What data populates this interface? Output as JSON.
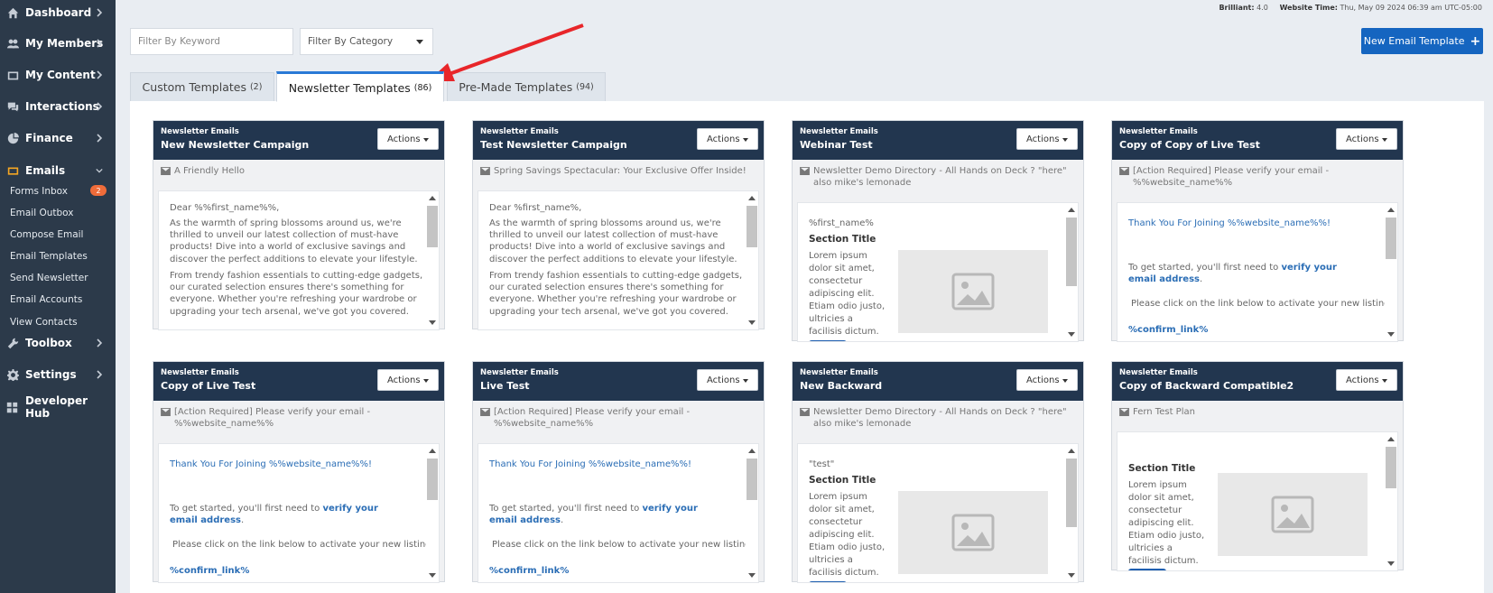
{
  "sidebar": {
    "items": [
      {
        "label": "Dashboard",
        "icon": "home-icon"
      },
      {
        "label": "My Members",
        "icon": "users-icon"
      },
      {
        "label": "My Content",
        "icon": "content-icon"
      },
      {
        "label": "Interactions",
        "icon": "chat-icon"
      },
      {
        "label": "Finance",
        "icon": "finance-icon"
      },
      {
        "label": "Emails",
        "icon": "envelope-icon"
      },
      {
        "label": "Toolbox",
        "icon": "wrench-icon"
      },
      {
        "label": "Settings",
        "icon": "gear-icon"
      },
      {
        "label": "Developer Hub",
        "icon": "grid-icon"
      }
    ],
    "email_subitems": [
      "Forms Inbox",
      "Email Outbox",
      "Compose Email",
      "Email Templates",
      "Send Newsletter",
      "Email Accounts",
      "View Contacts"
    ],
    "forms_inbox_badge": "2"
  },
  "topbar": {
    "version_label": "Brilliant:",
    "version": "4.0",
    "time_label": "Website Time:",
    "time": "Thu, May 09 2024 06:39 am UTC-05:00"
  },
  "filters": {
    "keyword_placeholder": "Filter By Keyword",
    "category_label": "Filter By Category"
  },
  "new_template_label": "New Email Template",
  "tabs": [
    {
      "label": "Custom Templates",
      "count": "(2)"
    },
    {
      "label": "Newsletter Templates",
      "count": "(86)"
    },
    {
      "label": "Pre-Made Templates",
      "count": "(94)"
    }
  ],
  "actions_label": "Actions",
  "cards": [
    {
      "category": "Newsletter Emails",
      "title": "New Newsletter Campaign",
      "subject": "A Friendly Hello",
      "preview": {
        "greeting": "Dear %%first_name%%,",
        "p1": "As the warmth of spring blossoms around us, we're thrilled to unveil our latest collection of must-have products! Dive into a world of exclusive savings and discover the perfect additions to elevate your lifestyle.",
        "p2": "From trendy fashion essentials to cutting-edge gadgets, our curated selection ensures there's something for everyone. Whether you're refreshing your wardrobe or upgrading your tech arsenal, we've got you covered."
      }
    },
    {
      "category": "Newsletter Emails",
      "title": "Test Newsletter Campaign",
      "subject": "Spring Savings Spectacular: Your Exclusive Offer Inside!",
      "preview": {
        "greeting": "Dear %first_name%,",
        "p1": "As the warmth of spring blossoms around us, we're thrilled to unveil our latest collection of must-have products! Dive into a world of exclusive savings and discover the perfect additions to elevate your lifestyle.",
        "p2": "From trendy fashion essentials to cutting-edge gadgets, our curated selection ensures there's something for everyone. Whether you're refreshing your wardrobe or upgrading your tech arsenal, we've got you covered."
      }
    },
    {
      "category": "Newsletter Emails",
      "title": "Webinar Test",
      "subject": "Newsletter Demo Directory - All Hands on Deck ? \"here\" also mike's lemonade",
      "preview": {
        "top": "%first_name%",
        "section": "Section Title",
        "body": "Lorem ipsum dolor sit amet, consectetur adipiscing elit. Etiam odio justo, ultricies a facilisis dictum."
      }
    },
    {
      "category": "Newsletter Emails",
      "title": "Copy of Copy of Live Test",
      "subject": "[Action Required] Please verify your email - %%website_name%%",
      "preview": {
        "thanks": "Thank You For Joining %%website_name%%!",
        "started": "To get started, you'll first need to",
        "verify": "verify your email address",
        "click": "Please click on the link below to activate your new listing.",
        "link": "%confirm_link%"
      }
    },
    {
      "category": "Newsletter Emails",
      "title": "Copy of Live Test",
      "subject": "[Action Required] Please verify your email - %%website_name%%",
      "preview": {
        "thanks": "Thank You For Joining %%website_name%%!",
        "started": "To get started, you'll first need to",
        "verify": "verify your email address",
        "click": "Please click on the link below to activate your new listing.",
        "link": "%confirm_link%"
      }
    },
    {
      "category": "Newsletter Emails",
      "title": "Live Test",
      "subject": "[Action Required] Please verify your email - %%website_name%%",
      "preview": {
        "thanks": "Thank You For Joining %%website_name%%!",
        "started": "To get started, you'll first need to",
        "verify": "verify your email address",
        "click": "Please click on the link below to activate your new listing.",
        "link": "%confirm_link%"
      }
    },
    {
      "category": "Newsletter Emails",
      "title": "New Backward",
      "subject": "Newsletter Demo Directory - All Hands on Deck ? \"here\" also mike's lemonade",
      "preview": {
        "top": "\"test\"",
        "section": "Section Title",
        "body": "Lorem ipsum dolor sit amet, consectetur adipiscing elit. Etiam odio justo, ultricies a facilisis dictum."
      }
    },
    {
      "category": "Newsletter Emails",
      "title": "Copy of Backward Compatible2",
      "subject": "Fern Test Plan",
      "preview": {
        "top": "",
        "section": "Section Title",
        "body": "Lorem ipsum dolor sit amet, consectetur adipiscing elit. Etiam odio justo, ultricies a facilisis dictum."
      }
    }
  ]
}
